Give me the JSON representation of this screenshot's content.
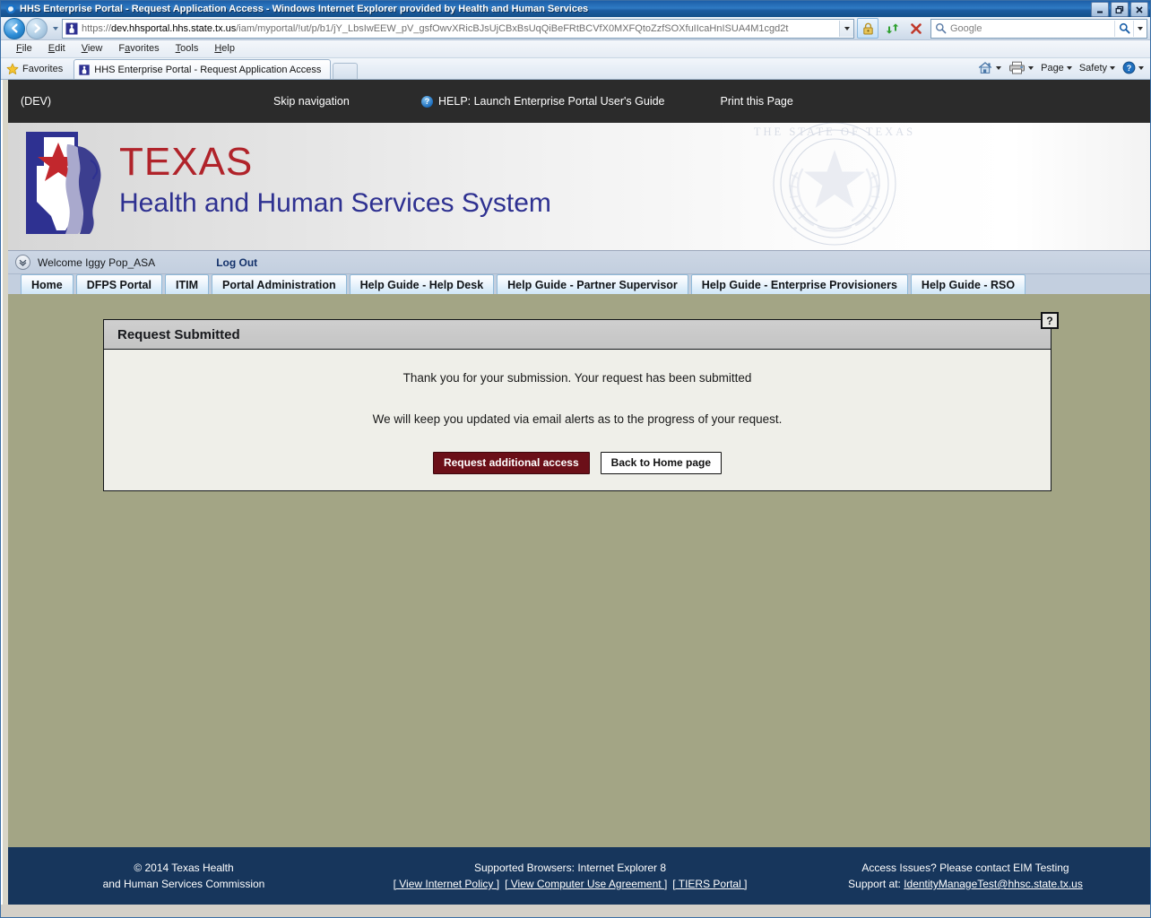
{
  "browser": {
    "window_title": "HHS Enterprise Portal - Request Application Access - Windows Internet Explorer provided by Health and Human Services",
    "window_buttons": {
      "minimize": "–",
      "restore": "❐",
      "close": "✕"
    },
    "url_protocol": "https://",
    "url_domain": "dev.hhsportal.hhs.state.tx.us",
    "url_path": "/iam/myportal/!ut/p/b1/jY_LbsIwEEW_pV_gsfOwvXRicBJsUjCBxBsUqQiBeFRtBCVfX0MXFQtoZzfSOXfuIIcaHnISUA4M1cgd2t",
    "search_placeholder": "Google",
    "menu": [
      {
        "label": "File",
        "accel": "F"
      },
      {
        "label": "Edit",
        "accel": "E"
      },
      {
        "label": "View",
        "accel": "V"
      },
      {
        "label": "Favorites",
        "accel": "a"
      },
      {
        "label": "Tools",
        "accel": "T"
      },
      {
        "label": "Help",
        "accel": "H"
      }
    ],
    "favorites_label": "Favorites",
    "tab_title": "HHS Enterprise Portal - Request Application Access",
    "command_bar": [
      {
        "name": "home",
        "label": ""
      },
      {
        "name": "print",
        "label": ""
      },
      {
        "name": "page",
        "label": "Page"
      },
      {
        "name": "safety",
        "label": "Safety"
      },
      {
        "name": "help",
        "label": ""
      }
    ]
  },
  "utilnav": {
    "environment": "(DEV)",
    "skip_navigation": "Skip navigation",
    "help_link": "HELP: Launch Enterprise Portal User's Guide",
    "print_page": "Print this Page",
    "help_icon_glyph": "?"
  },
  "brand": {
    "texas": "TEXAS",
    "subtitle": "Health and Human Services System",
    "seal_text": "THE STATE OF TEXAS",
    "colors": {
      "texas_red": "#b0232a",
      "hhs_blue": "#2e3191"
    }
  },
  "welcome": {
    "greeting": "Welcome Iggy Pop_ASA",
    "logout": "Log Out"
  },
  "tabs": [
    {
      "label": "Home"
    },
    {
      "label": "DFPS Portal"
    },
    {
      "label": "ITIM"
    },
    {
      "label": "Portal Administration"
    },
    {
      "label": "Help Guide - Help Desk"
    },
    {
      "label": "Help Guide - Partner Supervisor"
    },
    {
      "label": "Help Guide - Enterprise Provisioners"
    },
    {
      "label": "Help Guide - RSO"
    }
  ],
  "panel": {
    "title": "Request Submitted",
    "help_glyph": "?",
    "message_1": "Thank you for your submission. Your request has been submitted",
    "message_2": "We will keep you updated via email alerts as to the progress of your request.",
    "primary_button": "Request additional access",
    "secondary_button": "Back to Home page",
    "primary_color": "#6b0f18"
  },
  "footer": {
    "copyright_line1": "© 2014 Texas Health",
    "copyright_line2": "and Human Services Commission",
    "browsers": "Supported Browsers: Internet Explorer 8",
    "link_internet_policy": "[ View Internet Policy ]",
    "link_computer_use": "[ View Computer Use Agreement ]",
    "link_tiers": "[ TIERS Portal ]",
    "access_line1": "Access Issues? Please contact EIM Testing",
    "access_line2_prefix": "Support at: ",
    "support_email": "IdentityManageTest@hhsc.state.tx.us",
    "background": "#17365c"
  }
}
